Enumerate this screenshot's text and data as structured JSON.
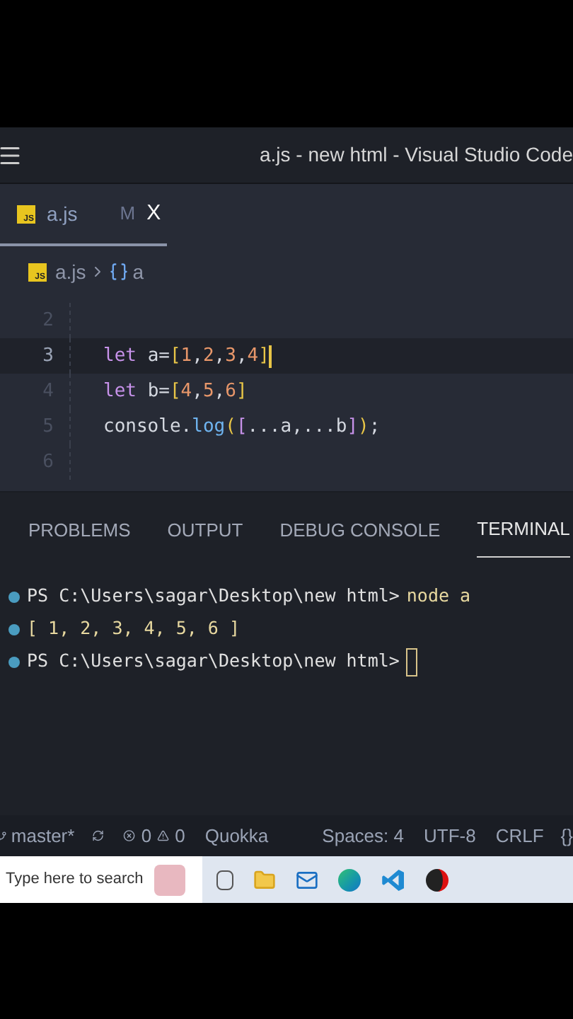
{
  "window": {
    "title": "a.js - new html - Visual Studio Code"
  },
  "tabs": [
    {
      "icon_label": "JS",
      "label": "a.js",
      "badge": "M",
      "close": "X",
      "selected": true
    }
  ],
  "breadcrumb": {
    "icon_label": "JS",
    "file": "a.js",
    "symbol": "a"
  },
  "editor": {
    "lines": [
      {
        "number": "2",
        "current": false
      },
      {
        "number": "3",
        "current": true,
        "cursor_after": true,
        "tokens": [
          {
            "kind": "keyword",
            "text": "let "
          },
          {
            "kind": "plain",
            "text": "a="
          },
          {
            "kind": "bracket",
            "text": "["
          },
          {
            "kind": "number",
            "text": "1"
          },
          {
            "kind": "plain",
            "text": ","
          },
          {
            "kind": "number",
            "text": "2"
          },
          {
            "kind": "plain",
            "text": ","
          },
          {
            "kind": "number",
            "text": "3"
          },
          {
            "kind": "plain",
            "text": ","
          },
          {
            "kind": "number",
            "text": "4"
          },
          {
            "kind": "bracket",
            "text": "]"
          }
        ]
      },
      {
        "number": "4",
        "current": false,
        "tokens": [
          {
            "kind": "keyword",
            "text": "let "
          },
          {
            "kind": "plain",
            "text": "b="
          },
          {
            "kind": "bracket",
            "text": "["
          },
          {
            "kind": "number",
            "text": "4"
          },
          {
            "kind": "plain",
            "text": ","
          },
          {
            "kind": "number",
            "text": "5"
          },
          {
            "kind": "plain",
            "text": ","
          },
          {
            "kind": "number",
            "text": "6"
          },
          {
            "kind": "bracket",
            "text": "]"
          }
        ]
      },
      {
        "number": "5",
        "current": false,
        "tokens": [
          {
            "kind": "plain",
            "text": "console."
          },
          {
            "kind": "func",
            "text": "log"
          },
          {
            "kind": "bracket",
            "text": "("
          },
          {
            "kind": "bracket2",
            "text": "["
          },
          {
            "kind": "plain",
            "text": "...a,...b"
          },
          {
            "kind": "bracket2",
            "text": "]"
          },
          {
            "kind": "bracket",
            "text": ")"
          },
          {
            "kind": "plain",
            "text": ";"
          }
        ]
      },
      {
        "number": "6",
        "current": false
      }
    ]
  },
  "panel_tabs": [
    {
      "label": "PROBLEMS",
      "selected": false
    },
    {
      "label": "OUTPUT",
      "selected": false
    },
    {
      "label": "DEBUG CONSOLE",
      "selected": false
    },
    {
      "label": "TERMINAL",
      "selected": true
    }
  ],
  "terminal": [
    {
      "kind": "prompt",
      "prompt": "PS C:\\Users\\sagar\\Desktop\\new html>",
      "command": "node a"
    },
    {
      "kind": "output",
      "text": "[ 1, 2, 3, 4, 5, 6 ]"
    },
    {
      "kind": "prompt",
      "prompt": "PS C:\\Users\\sagar\\Desktop\\new html>",
      "cursor": true
    }
  ],
  "status_bar": {
    "branch": "master*",
    "errors": "0",
    "warnings": "0",
    "quokka": "Quokka",
    "spaces": "Spaces: 4",
    "encoding": "UTF-8",
    "eol": "CRLF",
    "language": "{}"
  },
  "taskbar": {
    "search_placeholder": "Type here to search"
  }
}
